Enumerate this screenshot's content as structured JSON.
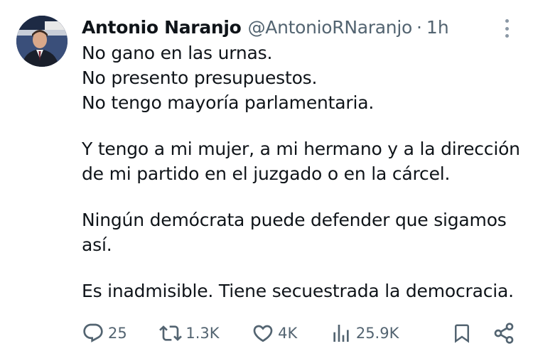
{
  "tweet": {
    "author": {
      "name": "Antonio Naranjo",
      "handle": "@AntonioRNaranjo",
      "avatar_alt": "profile-photo"
    },
    "separator": "·",
    "time": "1h",
    "text_lines": [
      "No gano en las urnas.",
      "No presento presupuestos.",
      "No tengo mayoría parlamentaria.",
      "",
      "Y tengo a mi mujer, a mi hermano y a la dirección",
      "de mi partido en el juzgado o en la cárcel.",
      "",
      "Ningún demócrata puede defender que sigamos",
      "así.",
      "",
      "Es inadmisible. Tiene secuestrada la democracia."
    ],
    "actions": {
      "replies": "25",
      "reposts": "1.3K",
      "likes": "4K",
      "views": "25.9K"
    }
  },
  "icons": {
    "reply": "reply-icon",
    "repost": "repost-icon",
    "like": "heart-icon",
    "views": "views-icon",
    "bookmark": "bookmark-icon",
    "share": "share-icon",
    "more": "more-vertical-icon"
  },
  "colors": {
    "text": "#0f1419",
    "secondary": "#536471"
  }
}
